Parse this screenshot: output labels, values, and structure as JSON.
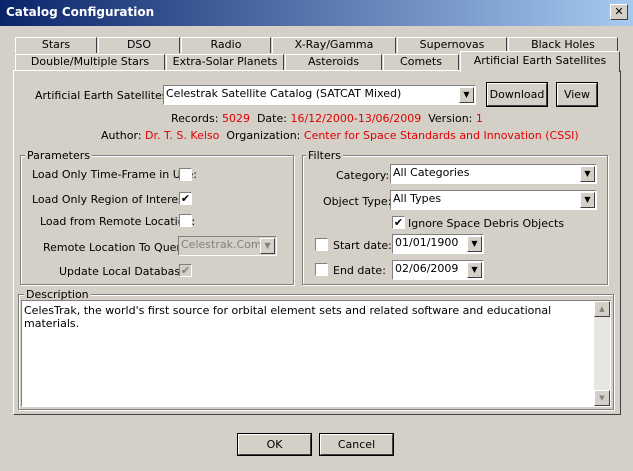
{
  "window": {
    "title": "Catalog Configuration",
    "close_glyph": "✕"
  },
  "tabs_row1": [
    "Stars",
    "DSO",
    "Radio",
    "X-Ray/Gamma",
    "Supernovas",
    "Black Holes"
  ],
  "tabs_row2": [
    "Double/Multiple Stars",
    "Extra-Solar Planets",
    "Asteroids",
    "Comets",
    "Artificial Earth Satellites"
  ],
  "catalog": {
    "label": "Artificial Earth Satellites:",
    "selected": "Celestrak Satellite Catalog (SATCAT Mixed)",
    "download_label": "Download",
    "view_label": "View",
    "records_label": "Records:",
    "records_value": "5029",
    "date_label": "Date:",
    "date_value": "16/12/2000-13/06/2009",
    "version_label": "Version:",
    "version_value": "1",
    "author_label": "Author:",
    "author_value": "Dr. T. S. Kelso",
    "org_label": "Organization:",
    "org_value": "Center for Space Standards and Innovation (CSSI)"
  },
  "parameters": {
    "title": "Parameters",
    "time_frame_label": "Load Only Time-Frame in Use:",
    "time_frame_checked": false,
    "region_label": "Load Only Region of Interest:",
    "region_checked": true,
    "remote_label": "Load from Remote Location:",
    "remote_checked": false,
    "remote_query_label": "Remote Location To Query:",
    "remote_query_value": "Celestrak.Com",
    "update_label": "Update Local Database:",
    "update_checked": true
  },
  "filters": {
    "title": "Filters",
    "category_label": "Category:",
    "category_value": "All Categories",
    "object_type_label": "Object Type:",
    "object_type_value": "All Types",
    "ignore_debris_label": "Ignore Space Debris Objects",
    "ignore_debris_checked": true,
    "start_label": "Start date:",
    "start_checked": false,
    "start_value": "01/01/1900",
    "end_label": "End date:",
    "end_checked": false,
    "end_value": "02/06/2009"
  },
  "description": {
    "title": "Description",
    "text": "CelesTrak, the world's first source for orbital element sets and related software and educational materials."
  },
  "footer": {
    "ok_label": "OK",
    "cancel_label": "Cancel"
  },
  "glyphs": {
    "check": "✔",
    "dropdown": "▼",
    "up": "▲",
    "down": "▼"
  },
  "colors": {
    "titlebar_start": "#0a246a",
    "titlebar_end": "#a6caf0",
    "highlight_red": "#e00000"
  }
}
